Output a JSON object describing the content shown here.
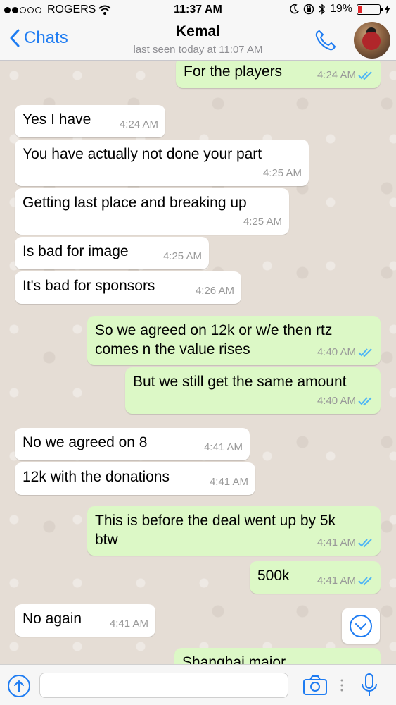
{
  "status_bar": {
    "carrier": "ROGERS",
    "time": "11:37 AM",
    "battery": "19%",
    "battery_level": 0.19,
    "signal_icon": "signal-dots-icon",
    "wifi_icon": "wifi-icon"
  },
  "header": {
    "back_label": "Chats",
    "contact_name": "Kemal",
    "last_seen": "last seen today at 11:07 AM"
  },
  "colors": {
    "accent": "#1e7cf2",
    "outgoing_bubble": "#dcf8c6",
    "incoming_bubble": "#ffffff",
    "read_ticks": "#4fb5f5"
  },
  "messages": [
    {
      "dir": "out",
      "text": "For the players",
      "time": "4:24 AM"
    },
    {
      "dir": "in",
      "text": "Yes I have",
      "time": "4:24 AM"
    },
    {
      "dir": "in",
      "text": "You have actually not done your part",
      "time": "4:25 AM"
    },
    {
      "dir": "in",
      "text": "Getting last place and breaking up",
      "time": "4:25 AM"
    },
    {
      "dir": "in",
      "text": "Is bad for image",
      "time": "4:25 AM"
    },
    {
      "dir": "in",
      "text": "It's bad for sponsors",
      "time": "4:26 AM"
    },
    {
      "dir": "out",
      "text": "So we agreed on 12k or w/e then rtz\ncomes n the value rises",
      "time": "4:40 AM"
    },
    {
      "dir": "out",
      "text": "But we still get the same amount",
      "time": "4:40 AM"
    },
    {
      "dir": "in",
      "text": "No we agreed on 8",
      "time": "4:41 AM"
    },
    {
      "dir": "in",
      "text": "12k with the donations",
      "time": "4:41 AM"
    },
    {
      "dir": "out",
      "text": "This is before the deal went up by 5k\nbtw",
      "time": "4:41 AM"
    },
    {
      "dir": "out",
      "text": "500k",
      "time": "4:41 AM"
    },
    {
      "dir": "in",
      "text": "No again",
      "time": "4:41 AM"
    },
    {
      "dir": "out",
      "text": "Shanghai major",
      "time": ""
    }
  ]
}
